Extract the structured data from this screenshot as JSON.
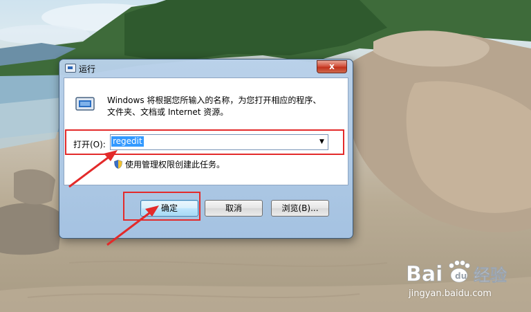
{
  "dialog": {
    "title": "运行",
    "close_glyph": "x",
    "description_line1": "Windows 将根据您所输入的名称，为您打开相应的程序、",
    "description_line2": "文件夹、文档或 Internet 资源。",
    "open_label": "打开(O):",
    "command_value": "regedit",
    "dropdown_glyph": "▼",
    "admin_note": "使用管理权限创建此任务。",
    "buttons": {
      "ok": "确定",
      "cancel": "取消",
      "browse": "浏览(B)..."
    }
  },
  "watermark": {
    "logo_text": "Bai",
    "logo_text2": "经验",
    "url": "jingyan.baidu.com"
  },
  "colors": {
    "annotation": "#e32a2a",
    "selection": "#3399ff"
  },
  "icons": [
    "run-icon",
    "shield-icon",
    "close-icon",
    "dropdown-arrow-icon",
    "paw-icon"
  ]
}
